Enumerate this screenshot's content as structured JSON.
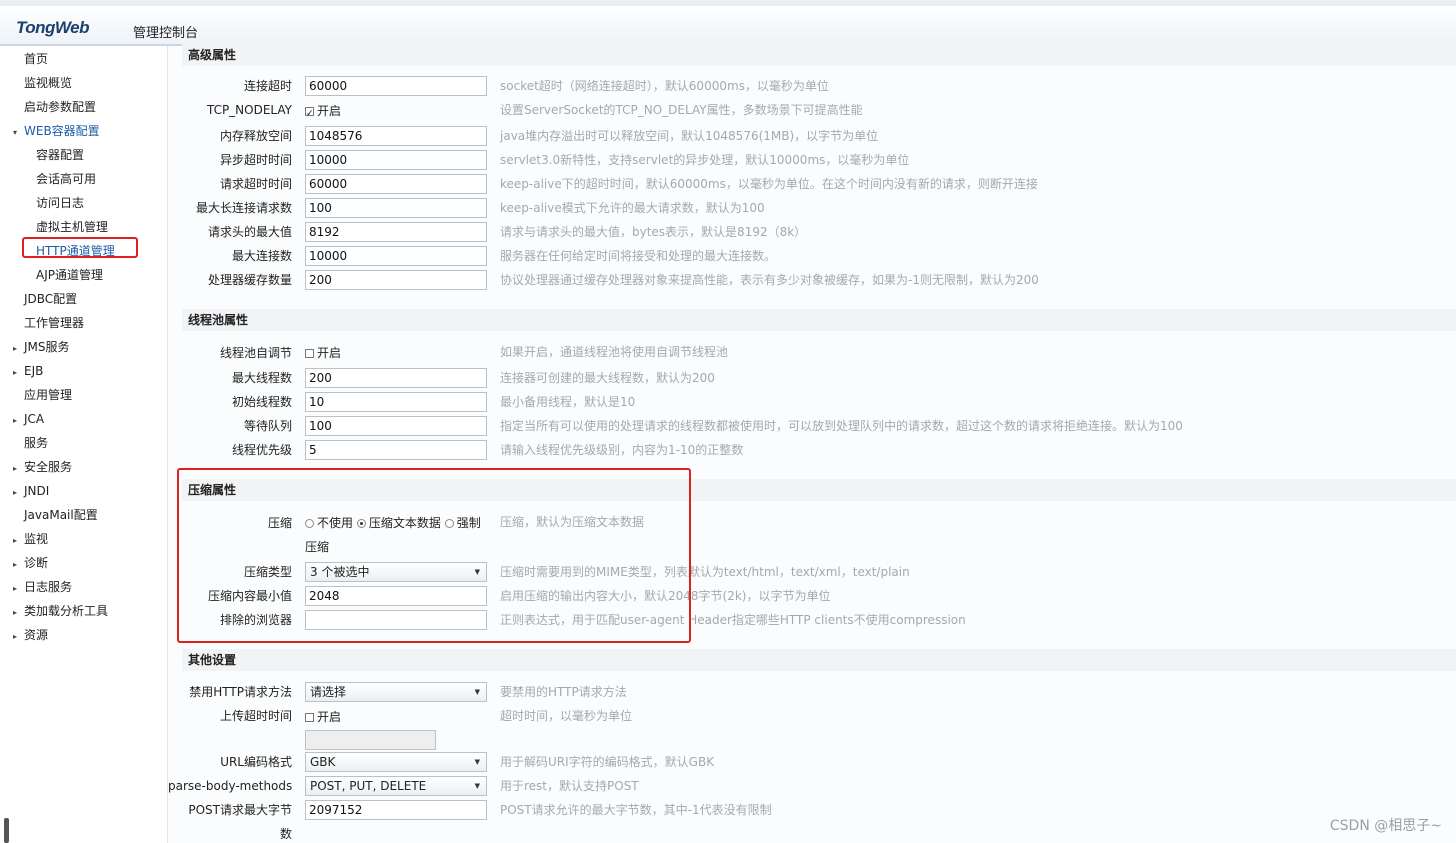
{
  "header": {
    "logo": "TongWeb",
    "title": "管理控制台"
  },
  "sidebar": {
    "items": [
      {
        "label": "首页",
        "level": 0,
        "arrow": ""
      },
      {
        "label": "监视概览",
        "level": 0,
        "arrow": ""
      },
      {
        "label": "启动参数配置",
        "level": 0,
        "arrow": ""
      },
      {
        "label": "WEB容器配置",
        "level": 0,
        "arrow": "▾"
      },
      {
        "label": "容器配置",
        "level": 1,
        "arrow": ""
      },
      {
        "label": "会话高可用",
        "level": 1,
        "arrow": ""
      },
      {
        "label": "访问日志",
        "level": 1,
        "arrow": ""
      },
      {
        "label": "虚拟主机管理",
        "level": 1,
        "arrow": ""
      },
      {
        "label": "HTTP通道管理",
        "level": 1,
        "arrow": ""
      },
      {
        "label": "AJP通道管理",
        "level": 1,
        "arrow": ""
      },
      {
        "label": "JDBC配置",
        "level": 0,
        "arrow": ""
      },
      {
        "label": "工作管理器",
        "level": 0,
        "arrow": ""
      },
      {
        "label": "JMS服务",
        "level": 0,
        "arrow": "▸"
      },
      {
        "label": "EJB",
        "level": 0,
        "arrow": "▸"
      },
      {
        "label": "应用管理",
        "level": 0,
        "arrow": ""
      },
      {
        "label": "JCA",
        "level": 0,
        "arrow": "▸"
      },
      {
        "label": "服务",
        "level": 0,
        "arrow": ""
      },
      {
        "label": "安全服务",
        "level": 0,
        "arrow": "▸"
      },
      {
        "label": "JNDI",
        "level": 0,
        "arrow": "▸"
      },
      {
        "label": "JavaMail配置",
        "level": 0,
        "arrow": ""
      },
      {
        "label": "监视",
        "level": 0,
        "arrow": "▸"
      },
      {
        "label": "诊断",
        "level": 0,
        "arrow": "▸"
      },
      {
        "label": "日志服务",
        "level": 0,
        "arrow": "▸"
      },
      {
        "label": "类加载分析工具",
        "level": 0,
        "arrow": "▸"
      },
      {
        "label": "资源",
        "level": 0,
        "arrow": "▸"
      }
    ]
  },
  "sections": {
    "advanced": "高级属性",
    "thread_pool": "线程池属性",
    "compression": "压缩属性",
    "other": "其他设置"
  },
  "advanced": {
    "conn_timeout": {
      "label": "连接超时",
      "value": "60000",
      "desc": "socket超时（网络连接超时），默认60000ms，以毫秒为单位"
    },
    "tcp_nodelay": {
      "label": "TCP_NODELAY",
      "check": "开启",
      "desc": "设置ServerSocket的TCP_NO_DELAY属性，多数场景下可提高性能"
    },
    "mem_release": {
      "label": "内存释放空间",
      "value": "1048576",
      "desc": "java堆内存溢出时可以释放空间，默认1048576(1MB)，以字节为单位"
    },
    "async_timeout": {
      "label": "异步超时时间",
      "value": "10000",
      "desc": "servlet3.0新特性，支持servlet的异步处理，默认10000ms，以毫秒为单位"
    },
    "req_timeout": {
      "label": "请求超时时间",
      "value": "60000",
      "desc": "keep-alive下的超时时间，默认60000ms，以毫秒为单位。在这个时间内没有新的请求，则断开连接"
    },
    "max_keepalive": {
      "label": "最大长连接请求数",
      "value": "100",
      "desc": "keep-alive模式下允许的最大请求数，默认为100"
    },
    "max_header": {
      "label": "请求头的最大值",
      "value": "8192",
      "desc": "请求与请求头的最大值，bytes表示，默认是8192（8k）"
    },
    "max_conn": {
      "label": "最大连接数",
      "value": "10000",
      "desc": "服务器在任何给定时间将接受和处理的最大连接数。"
    },
    "proc_cache": {
      "label": "处理器缓存数量",
      "value": "200",
      "desc": "协议处理器通过缓存处理器对象来提高性能，表示有多少对象被缓存，如果为-1则无限制，默认为200"
    }
  },
  "thread": {
    "auto_adjust": {
      "label": "线程池自调节",
      "check": "开启",
      "desc": "如果开启，通道线程池将使用自调节线程池"
    },
    "max_threads": {
      "label": "最大线程数",
      "value": "200",
      "desc": "连接器可创建的最大线程数，默认为200"
    },
    "init_threads": {
      "label": "初始线程数",
      "value": "10",
      "desc": "最小备用线程，默认是10"
    },
    "queue": {
      "label": "等待队列",
      "value": "100",
      "desc": "指定当所有可以使用的处理请求的线程数都被使用时，可以放到处理队列中的请求数，超过这个数的请求将拒绝连接。默认为100"
    },
    "priority": {
      "label": "线程优先级",
      "value": "5",
      "desc": "请输入线程优先级级别，内容为1-10的正整数"
    }
  },
  "compress": {
    "mode": {
      "label": "压缩",
      "opt1": "不使用",
      "opt2": "压缩文本数据",
      "opt3": "强制",
      "sub": "压缩",
      "desc": "压缩，默认为压缩文本数据"
    },
    "type": {
      "label": "压缩类型",
      "value": "3 个被选中",
      "desc": "压缩时需要用到的MIME类型，列表默认为text/html，text/xml，text/plain"
    },
    "min_size": {
      "label": "压缩内容最小值",
      "value": "2048",
      "desc": "启用压缩的输出内容大小，默认2048字节(2k)，以字节为单位"
    },
    "excluded": {
      "label": "排除的浏览器",
      "value": "",
      "desc": "正则表达式，用于匹配user-agent Header指定哪些HTTP clients不使用compression"
    }
  },
  "other": {
    "disable_method": {
      "label": "禁用HTTP请求方法",
      "value": "请选择",
      "desc": "要禁用的HTTP请求方法"
    },
    "upload_timeout": {
      "label": "上传超时时间",
      "check": "开启",
      "desc": "超时时间，以毫秒为单位"
    },
    "uri_encoding": {
      "label": "URL编码格式",
      "value": "GBK",
      "desc": "用于解码URI字符的编码格式，默认GBK"
    },
    "parse_body": {
      "label": "parse-body-methods",
      "value": "POST, PUT, DELETE",
      "desc": "用于rest，默认支持POST"
    },
    "post_max": {
      "label": "POST请求最大字节",
      "label2": "数",
      "value": "2097152",
      "desc": "POST请求允许的最大字节数，其中-1代表没有限制"
    }
  },
  "watermark": "CSDN @相思子~"
}
